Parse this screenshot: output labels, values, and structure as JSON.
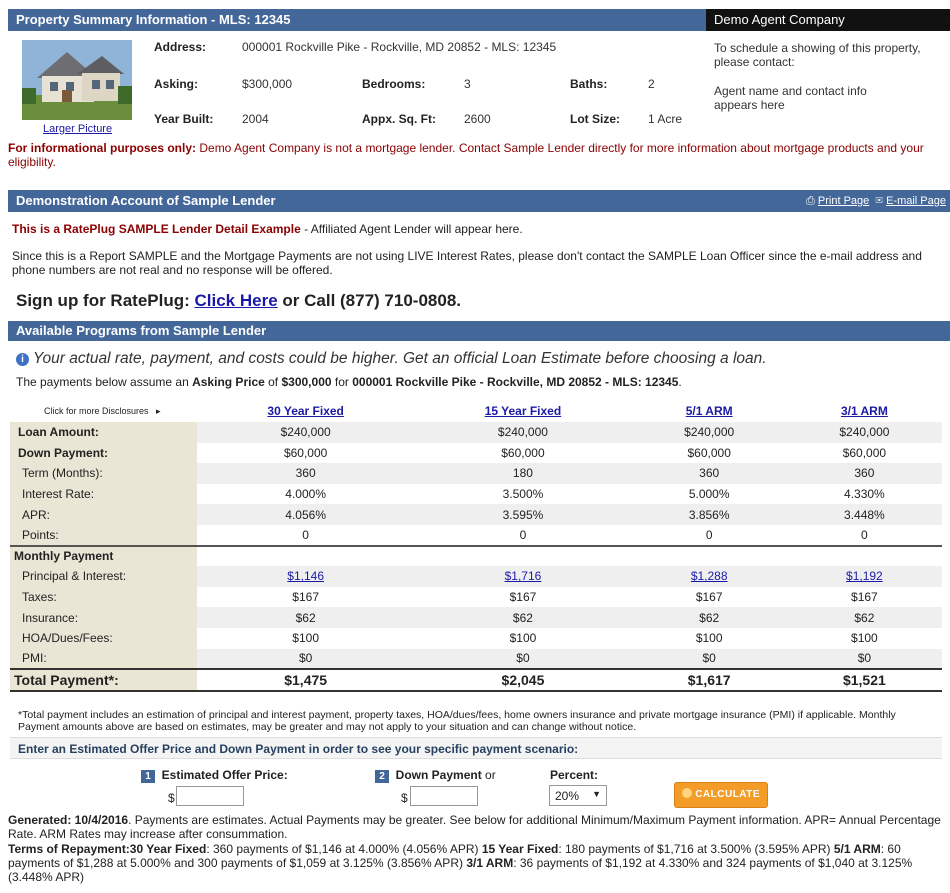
{
  "header": {
    "title": "Property Summary Information - MLS: 12345",
    "agent_company": "Demo Agent Company"
  },
  "property": {
    "larger_picture": "Larger Picture",
    "address_label": "Address:",
    "address_value": "000001 Rockville Pike - Rockville, MD 20852 - MLS: 12345",
    "asking_label": "Asking:",
    "asking_value": "$300,000",
    "bedrooms_label": "Bedrooms:",
    "bedrooms_value": "3",
    "baths_label": "Baths:",
    "baths_value": "2",
    "year_label": "Year Built:",
    "year_value": "2004",
    "sqft_label": "Appx. Sq. Ft:",
    "sqft_value": "2600",
    "lot_label": "Lot Size:",
    "lot_value": "1 Acre"
  },
  "agent": {
    "schedule": "To schedule a showing of this property, please contact:",
    "contact": "Agent name and contact info appears here"
  },
  "notice": {
    "bold": "For informational purposes only:",
    "text": " Demo Agent Company is not a mortgage lender. Contact Sample Lender directly for more information about mortgage products and your eligibility."
  },
  "lender": {
    "title": "Demonstration Account of Sample Lender",
    "print": "Print Page",
    "email": "E-mail Page"
  },
  "sample": {
    "bold": "This is a RatePlug SAMPLE Lender Detail Example",
    "text": " - Affiliated Agent Lender will appear here.",
    "disclaimer": "Since this is a Report SAMPLE and the Mortgage Payments are not using LIVE Interest Rates, please don't contact the SAMPLE Loan Officer since the e-mail address and phone numbers are not real and no response will be offered."
  },
  "signup": {
    "pre": "Sign up for RatePlug: ",
    "link": "Click Here",
    "post": " or Call (877) 710-0808."
  },
  "programs": {
    "title": "Available Programs from Sample Lender"
  },
  "warning": "Your actual rate, payment, and costs could be higher. Get an official Loan Estimate before choosing a loan.",
  "assume": {
    "t1": "The payments below assume an ",
    "b1": "Asking Price",
    "t2": " of ",
    "b2": "$300,000",
    "t3": " for ",
    "b3": "000001 Rockville Pike - Rockville, MD 20852 - MLS: 12345",
    "t4": "."
  },
  "table": {
    "disclosures": "Click for more Disclosures",
    "columns": [
      "30 Year Fixed",
      "15 Year Fixed",
      "5/1 ARM",
      "3/1 ARM"
    ],
    "loan_amount": {
      "label": "Loan Amount:",
      "values": [
        "$240,000",
        "$240,000",
        "$240,000",
        "$240,000"
      ]
    },
    "down_payment": {
      "label": "Down Payment:",
      "values": [
        "$60,000",
        "$60,000",
        "$60,000",
        "$60,000"
      ]
    },
    "term": {
      "label": "Term (Months):",
      "values": [
        "360",
        "180",
        "360",
        "360"
      ]
    },
    "rate": {
      "label": "Interest Rate:",
      "values": [
        "4.000%",
        "3.500%",
        "5.000%",
        "4.330%"
      ]
    },
    "apr": {
      "label": "APR:",
      "values": [
        "4.056%",
        "3.595%",
        "3.856%",
        "3.448%"
      ]
    },
    "points": {
      "label": "Points:",
      "values": [
        "0",
        "0",
        "0",
        "0"
      ]
    },
    "monthly": {
      "label": "Monthly Payment"
    },
    "pi": {
      "label": "Principal & Interest:",
      "values": [
        "$1,146",
        "$1,716",
        "$1,288",
        "$1,192"
      ]
    },
    "taxes": {
      "label": "Taxes:",
      "values": [
        "$167",
        "$167",
        "$167",
        "$167"
      ]
    },
    "insurance": {
      "label": "Insurance:",
      "values": [
        "$62",
        "$62",
        "$62",
        "$62"
      ]
    },
    "hoa": {
      "label": "HOA/Dues/Fees:",
      "values": [
        "$100",
        "$100",
        "$100",
        "$100"
      ]
    },
    "pmi": {
      "label": "PMI:",
      "values": [
        "$0",
        "$0",
        "$0",
        "$0"
      ]
    },
    "total": {
      "label": "Total Payment*:",
      "values": [
        "$1,475",
        "$2,045",
        "$1,617",
        "$1,521"
      ]
    }
  },
  "footnote": "*Total payment includes an estimation of principal and interest payment, property taxes, HOA/dues/fees, home owners insurance and private mortgage insurance (PMI) if applicable. Monthly Payment amounts above are based on estimates, may be greater and may not apply to your situation and can change without notice.",
  "estimate": {
    "title": "Enter an Estimated Offer Price and Down Payment in order to see your specific payment scenario:",
    "n1": "1",
    "offer_label": "Estimated Offer Price:",
    "n2": "2",
    "down_label": "Down Payment",
    "or": "or",
    "percent_label": "Percent:",
    "dollar": "$",
    "percent_value": "20%",
    "calculate": "CALCULATE"
  },
  "generated": {
    "bold": "Generated: 10/4/2016",
    "text": ". Payments are estimates. Actual Payments may be greater. See below for additional Minimum/Maximum Payment information.  APR= Annual Percentage Rate. ARM Rates may increase after consummation."
  },
  "terms": {
    "b0": "Terms of Repayment:30 Year Fixed",
    "t0": ": 360 payments of $1,146 at 4.000% (4.056% APR)  ",
    "b1": "15 Year Fixed",
    "t1": ": 180 payments of $1,716 at 3.500% (3.595% APR)  ",
    "b2": "5/1 ARM",
    "t2": ": 60 payments of $1,288 at 5.000% and 300 payments of $1,059 at 3.125% (3.856% APR)  ",
    "b3": "3/1 ARM",
    "t3": ": 36 payments of $1,192 at 4.330% and 324 payments of $1,040 at 3.125% (3.448% APR)"
  },
  "colors": {
    "header_blue": "#44679a",
    "label_bg": "#e9e6d6",
    "link": "#1a1aa6",
    "calc_orange": "#f39c27",
    "notice_red": "#8b0000"
  }
}
